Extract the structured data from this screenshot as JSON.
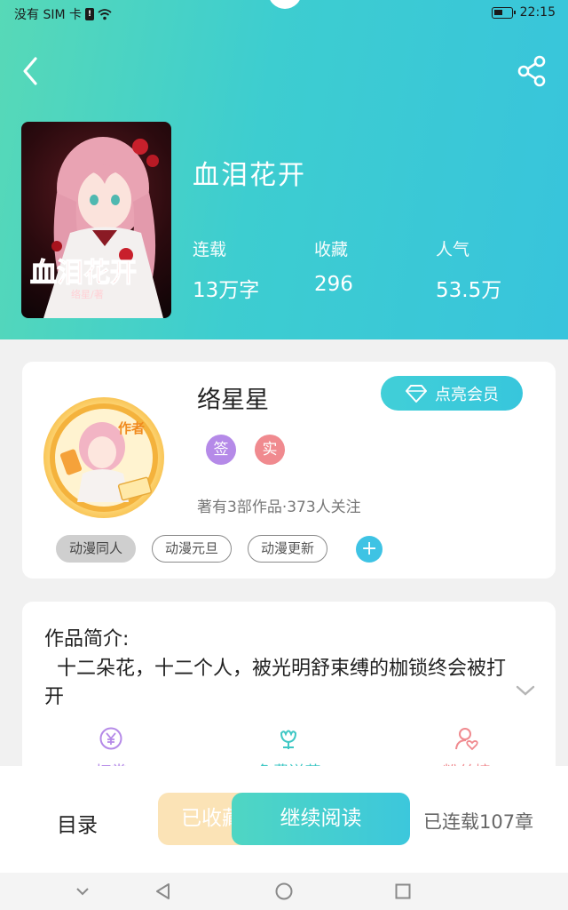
{
  "status_bar": {
    "carrier": "没有 SIM 卡",
    "time": "22:15"
  },
  "header": {
    "back_icon": "chevron-left-icon",
    "share_icon": "share-icon",
    "background_gradient": [
      "#57d9b7",
      "#38c4dc"
    ]
  },
  "book": {
    "title": "血泪花开",
    "cover_text": "血泪花开",
    "cover_author": "络星/著",
    "stats": [
      {
        "label": "连载",
        "value": "13万字"
      },
      {
        "label": "收藏",
        "value": "296"
      },
      {
        "label": "人气",
        "value": "53.5万"
      }
    ]
  },
  "author": {
    "name": "络星星",
    "avatar_badge": "作者",
    "vip_button": "点亮会员",
    "badges": [
      "签",
      "实"
    ],
    "meta": "著有3部作品·373人关注",
    "tags": [
      {
        "label": "动漫同人",
        "active": true
      },
      {
        "label": "动漫元旦",
        "active": false
      },
      {
        "label": "动漫更新",
        "active": false
      }
    ],
    "add_tag": "+"
  },
  "intro": {
    "heading": "作品简介:",
    "text": "十二朵花，十二个人，被光明舒束缚的枷锁终会被打开",
    "actions": [
      {
        "label": "打赏",
        "icon": "yen-coin-icon",
        "color": "#b58ae8"
      },
      {
        "label": "免费送花",
        "icon": "flower-icon",
        "color": "#3ec7c4"
      },
      {
        "label": "粉丝榜",
        "icon": "user-heart-icon",
        "color": "#f08a8f"
      }
    ]
  },
  "bottom_bar": {
    "toc": "目录",
    "collected": "已收藏",
    "continue": "继续阅读",
    "chapters": "已连载107章"
  },
  "navbar": {
    "icons": [
      "chevron-down-icon",
      "back-triangle-icon",
      "home-circle-icon",
      "recents-square-icon"
    ]
  }
}
